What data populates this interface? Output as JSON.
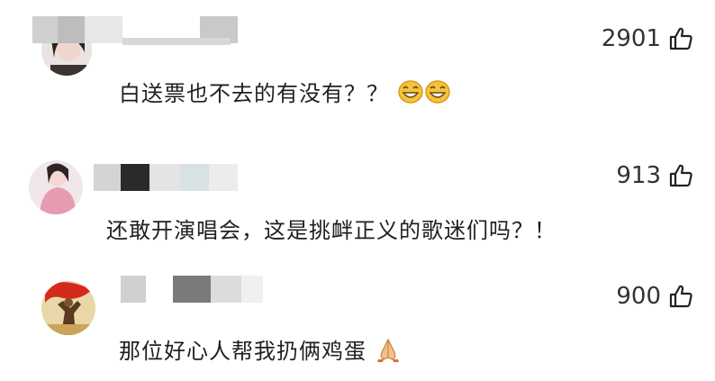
{
  "comments": [
    {
      "text": "白送票也不去的有没有？？",
      "emoji": [
        "grinning-face-emoji",
        "grinning-face-emoji"
      ],
      "likes": "2901",
      "avatar": "woman-portrait"
    },
    {
      "text": "还敢开演唱会，这是挑衅正义的歌迷们吗？！",
      "likes": "913",
      "avatar": "woman-pink-outfit"
    },
    {
      "text": "那位好心人帮我扔俩鸡蛋",
      "emoji": [
        "folded-hands-emoji"
      ],
      "likes": "900",
      "avatar": "red-flag-figure"
    }
  ],
  "colors": {
    "text": "#1f1f1f",
    "count": "#333333",
    "emoji": "#f6c33b"
  }
}
